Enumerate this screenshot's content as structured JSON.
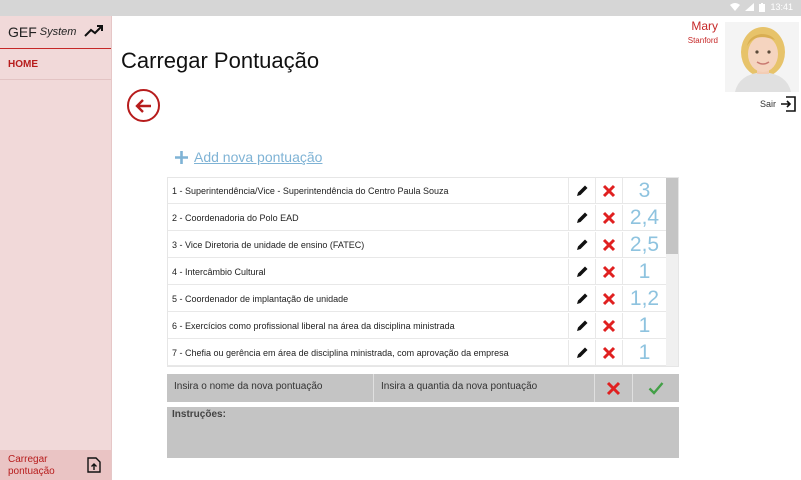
{
  "status_bar": {
    "time": "13:41"
  },
  "sidebar": {
    "brand_main": "GEF",
    "brand_sub": "System",
    "home_label": "HOME",
    "bottom_label": "Carregar pontuação"
  },
  "user": {
    "name": "Mary",
    "surname": "Stanford",
    "logout_label": "Sair"
  },
  "page": {
    "title": "Carregar Pontuação",
    "add_label": "Add nova pontuação"
  },
  "scores": [
    {
      "name": "1 - Superintendência/Vice - Superintendência do Centro Paula Souza",
      "value": "3"
    },
    {
      "name": "2 - Coordenadoria do Polo EAD",
      "value": "2,4"
    },
    {
      "name": "3 - Vice Diretoria de unidade de ensino (FATEC)",
      "value": "2,5"
    },
    {
      "name": "4 - Intercâmbio Cultural",
      "value": "1"
    },
    {
      "name": "5 - Coordenador de implantação de unidade",
      "value": "1,2"
    },
    {
      "name": "6 - Exercícios como profissional liberal na área da disciplina ministrada",
      "value": "1"
    },
    {
      "name": "7 - Chefia ou gerência em área de disciplina ministrada, com aprovação da empresa",
      "value": "1"
    }
  ],
  "new_score": {
    "name_placeholder": "Insira o nome da nova pontuação",
    "qty_placeholder": "Insira a quantia da nova pontuação"
  },
  "instructions": {
    "label": "Instruções:"
  },
  "colors": {
    "accent": "#c62828",
    "value_blue": "#8ec3df",
    "sidebar_bg": "#f1d9d9",
    "confirm_green": "#43a047"
  }
}
